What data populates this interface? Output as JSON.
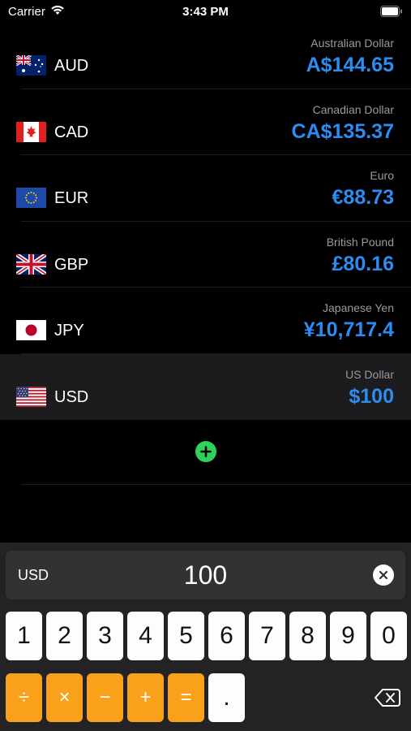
{
  "status_bar": {
    "carrier": "Carrier",
    "time": "3:43 PM"
  },
  "currencies": [
    {
      "code": "AUD",
      "name": "Australian Dollar",
      "amount": "A$144.65",
      "flag": "australia-flag"
    },
    {
      "code": "CAD",
      "name": "Canadian Dollar",
      "amount": "CA$135.37",
      "flag": "canada-flag"
    },
    {
      "code": "EUR",
      "name": "Euro",
      "amount": "€88.73",
      "flag": "eu-flag"
    },
    {
      "code": "GBP",
      "name": "British Pound",
      "amount": "£80.16",
      "flag": "uk-flag"
    },
    {
      "code": "JPY",
      "name": "Japanese Yen",
      "amount": "¥10,717.4",
      "flag": "japan-flag"
    },
    {
      "code": "USD",
      "name": "US Dollar",
      "amount": "$100",
      "flag": "us-flag",
      "selected": true
    }
  ],
  "input": {
    "code": "USD",
    "value": "100"
  },
  "keypad": {
    "digits": [
      "1",
      "2",
      "3",
      "4",
      "5",
      "6",
      "7",
      "8",
      "9",
      "0"
    ],
    "operators": [
      "÷",
      "×",
      "−",
      "+",
      "="
    ],
    "decimal": "."
  },
  "colors": {
    "accent": "#2d8cf0",
    "add": "#30d158",
    "operator": "#f9a11b"
  }
}
